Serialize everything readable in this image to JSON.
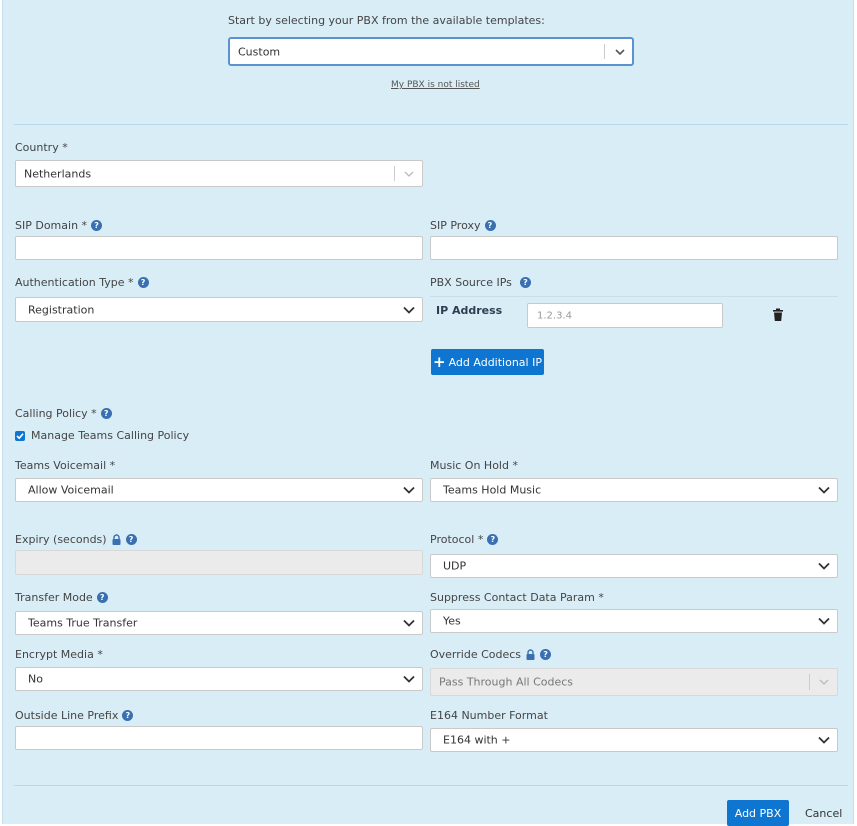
{
  "template": {
    "prompt": "Start by selecting your PBX from the available templates:",
    "selected": "Custom",
    "not_listed_link": "My PBX is not listed"
  },
  "country": {
    "label": "Country *",
    "value": "Netherlands"
  },
  "sip_domain": {
    "label": "SIP Domain *",
    "value": ""
  },
  "sip_proxy": {
    "label": "SIP Proxy",
    "value": ""
  },
  "auth_type": {
    "label": "Authentication Type *",
    "value": "Registration"
  },
  "pbx_source_ips": {
    "label": "PBX Source IPs",
    "column_header": "IP Address",
    "ip_placeholder": "1.2.3.4",
    "add_button": "Add Additional IP"
  },
  "calling_policy": {
    "label": "Calling Policy *",
    "checkbox_label": "Manage Teams Calling Policy",
    "checked": true
  },
  "teams_voicemail": {
    "label": "Teams Voicemail *",
    "value": "Allow Voicemail"
  },
  "music_on_hold": {
    "label": "Music On Hold *",
    "value": "Teams Hold Music"
  },
  "expiry": {
    "label": "Expiry (seconds)",
    "value": ""
  },
  "protocol": {
    "label": "Protocol *",
    "value": "UDP"
  },
  "transfer_mode": {
    "label": "Transfer Mode",
    "value": "Teams True Transfer"
  },
  "suppress_contact": {
    "label": "Suppress Contact Data Param *",
    "value": "Yes"
  },
  "encrypt_media": {
    "label": "Encrypt Media *",
    "value": "No"
  },
  "override_codecs": {
    "label": "Override Codecs",
    "value": "Pass Through All Codecs"
  },
  "outside_line_prefix": {
    "label": "Outside Line Prefix",
    "value": ""
  },
  "e164_format": {
    "label": "E164 Number Format",
    "value": "E164 with +"
  },
  "footer": {
    "add_button": "Add PBX",
    "cancel_button": "Cancel"
  },
  "icons": {
    "help": "help-circle-icon",
    "lock": "lock-icon",
    "chevron": "chevron-down-icon",
    "trash": "trash-icon",
    "plus": "plus-icon",
    "check": "checkbox-checked-icon"
  },
  "colors": {
    "panel_bg": "#d9edf7",
    "primary": "#0e75d1",
    "help_icon": "#3a6fb0"
  }
}
